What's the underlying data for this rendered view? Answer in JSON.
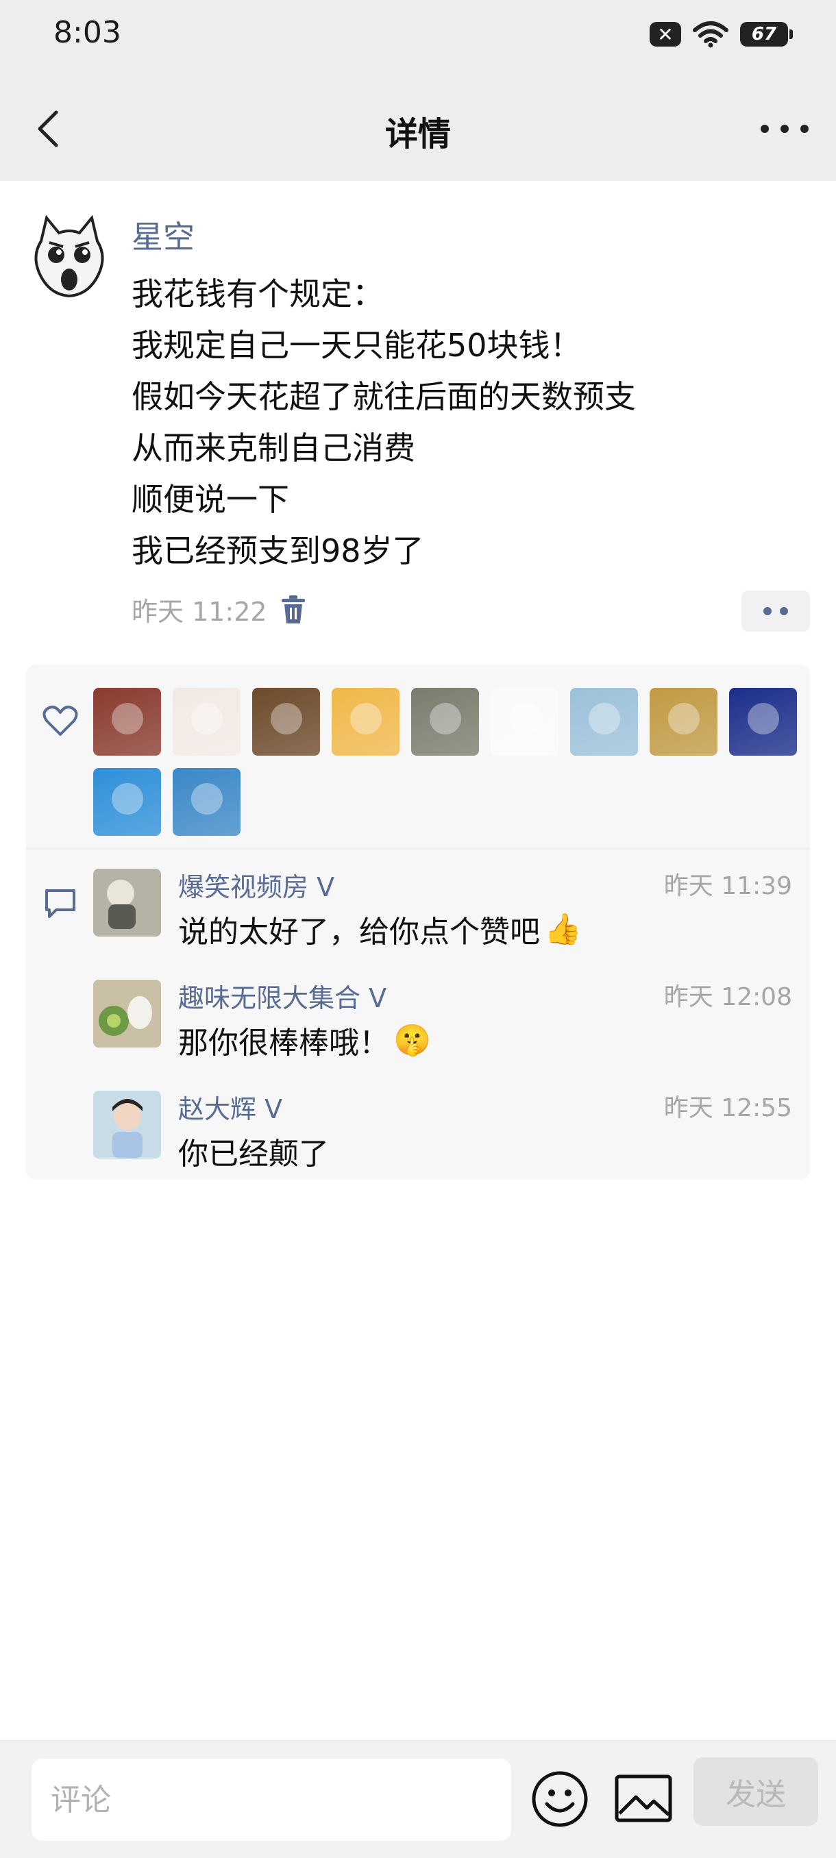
{
  "status_bar": {
    "time": "8:03",
    "battery": "67",
    "signal_icon": "signal-off-icon",
    "wifi_icon": "wifi-icon"
  },
  "header": {
    "title": "详情",
    "back_icon": "chevron-left-icon",
    "more_icon": "more-dots-icon"
  },
  "post": {
    "author": "星空",
    "lines": [
      "我花钱有个规定：",
      "我规定自己一天只能花50块钱！",
      "假如今天花超了就往后面的天数预支",
      "从而来克制自己消费",
      "顺便说一下",
      "我已经预支到98岁了"
    ],
    "time": "昨天 11:22",
    "delete_icon": "trash-icon",
    "action_icon": "two-dots-icon"
  },
  "likes": {
    "icon": "heart-icon",
    "avatars": [
      {
        "name": "avatar-man-red-wall",
        "color": "#8a3b2e"
      },
      {
        "name": "avatar-girl-cartoon",
        "color": "#f3e9e4"
      },
      {
        "name": "avatar-dog",
        "color": "#6d4a2b"
      },
      {
        "name": "avatar-girl-yellow",
        "color": "#f0b84a"
      },
      {
        "name": "avatar-rabbit-plush",
        "color": "#7b7b6e"
      },
      {
        "name": "avatar-meme-face",
        "color": "#fafafa"
      },
      {
        "name": "avatar-little-girl",
        "color": "#9cc1d9"
      },
      {
        "name": "avatar-sunset",
        "color": "#c19a44"
      },
      {
        "name": "avatar-anime-eye",
        "color": "#1c2e8a"
      },
      {
        "name": "avatar-dandelion",
        "color": "#2f8fd8"
      },
      {
        "name": "avatar-girl-blue-sky",
        "color": "#3b88c8"
      }
    ]
  },
  "comments": {
    "icon": "comment-bubble-icon",
    "items": [
      {
        "author": "爆笑视频房 V",
        "time": "昨天 11:39",
        "text": "说的太好了，给你点个赞吧",
        "emoji": "👍",
        "avatar_color": "#7d7d72"
      },
      {
        "author": "趣味无限大集合 V",
        "time": "昨天 12:08",
        "text": "那你很棒棒哦！",
        "emoji": "🤫",
        "avatar_color": "#a9b98e"
      },
      {
        "author": "赵大辉 V",
        "time": "昨天 12:55",
        "text": "你已经颠了",
        "emoji": "",
        "avatar_color": "#9cc1d9"
      }
    ]
  },
  "input_bar": {
    "placeholder": "评论",
    "send_label": "发送",
    "emoji_icon": "smiley-icon",
    "image_icon": "image-icon"
  },
  "colors": {
    "link": "#576b95",
    "muted": "#a6a6a6",
    "panel": "#f7f7f7",
    "header_bg": "#ededed"
  }
}
